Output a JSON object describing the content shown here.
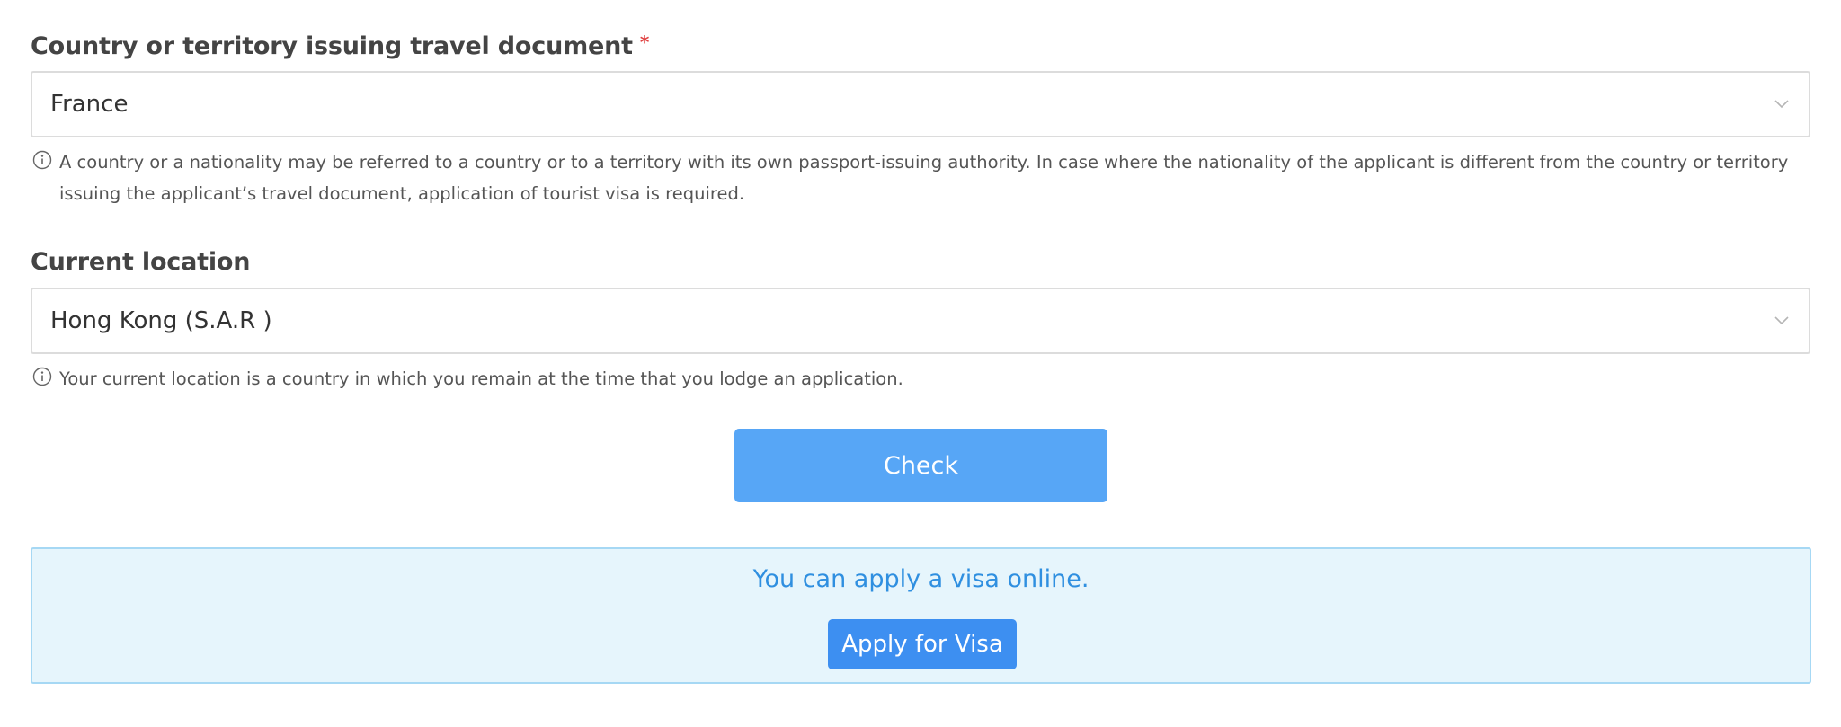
{
  "travel_document": {
    "label": "Country or territory issuing travel document",
    "required_marker": "*",
    "selected_value": "France",
    "hint": "A country or a nationality may be referred to a country or to a territory with its own passport-issuing authority. In case where the nationality of the applicant is different from the country or territory issuing the applicant’s travel document, application of tourist visa is required."
  },
  "current_location": {
    "label": "Current location",
    "selected_value": "Hong Kong (S.A.R )",
    "hint": "Your current location is a country in which you remain at the time that you lodge an application."
  },
  "actions": {
    "check_label": "Check"
  },
  "result": {
    "message": "You can apply a visa online.",
    "apply_label": "Apply for Visa"
  },
  "icons": {
    "dropdown": "chevron-down-icon",
    "hint": "info-icon"
  },
  "colors": {
    "required": "#e04343",
    "check_button": "#57a6f6",
    "apply_button": "#3d8ff1",
    "result_background": "#e6f5fc",
    "result_border": "#a6d8f4",
    "result_text": "#2f8fe0"
  }
}
